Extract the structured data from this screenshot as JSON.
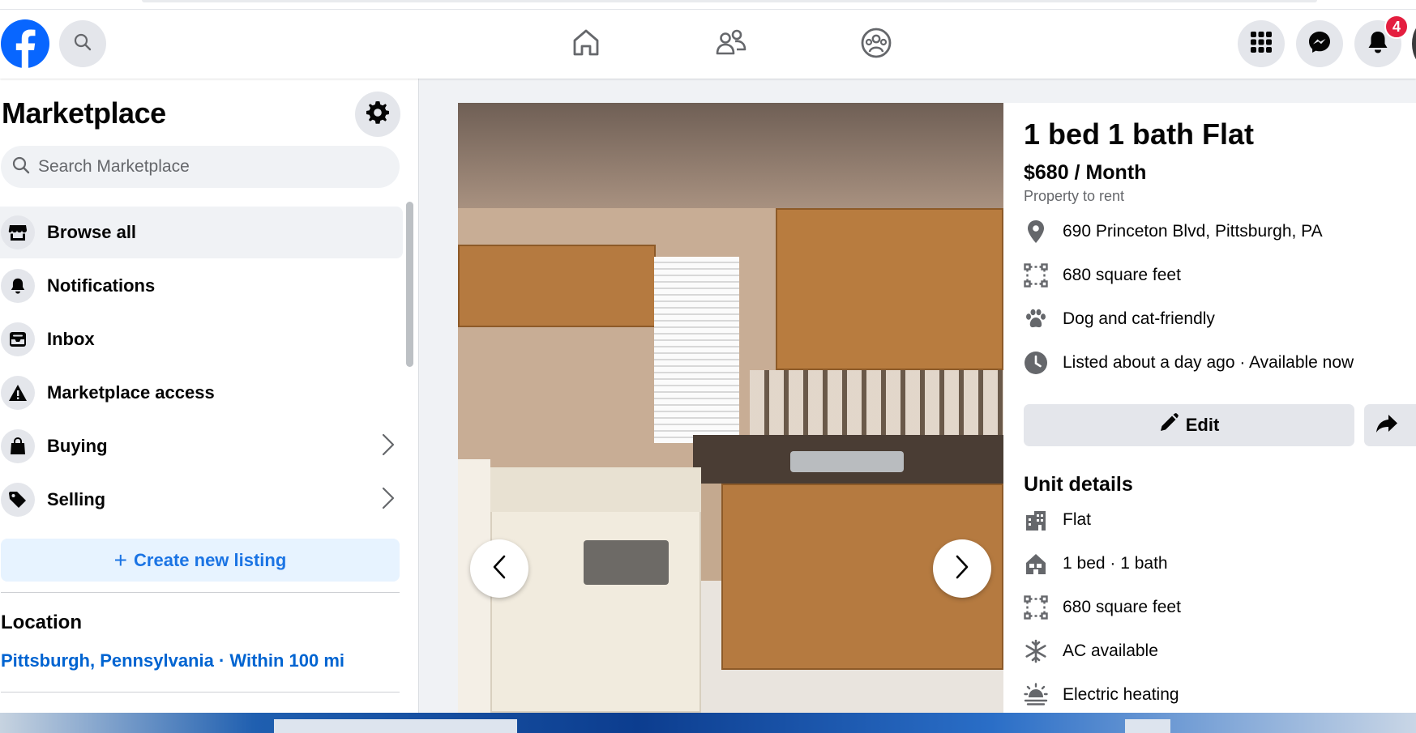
{
  "header": {
    "logo": "facebook-logo",
    "search_icon": "search-icon",
    "nav": [
      "home-icon",
      "friends-icon",
      "groups-icon"
    ],
    "right": [
      "menu-grid-icon",
      "messenger-icon",
      "bell-icon"
    ],
    "notification_count": "4"
  },
  "sidebar": {
    "title": "Marketplace",
    "search_placeholder": "Search Marketplace",
    "items": [
      {
        "label": "Browse all",
        "icon": "storefront-icon",
        "active": true
      },
      {
        "label": "Notifications",
        "icon": "bell-icon"
      },
      {
        "label": "Inbox",
        "icon": "inbox-icon"
      },
      {
        "label": "Marketplace access",
        "icon": "warning-icon"
      },
      {
        "label": "Buying",
        "icon": "shopping-bag-icon",
        "chevron": true
      },
      {
        "label": "Selling",
        "icon": "tag-icon",
        "chevron": true
      }
    ],
    "create_label": "Create new listing",
    "location_title": "Location",
    "location_value": "Pittsburgh, Pennsylvania · Within 100 mi"
  },
  "listing": {
    "title": "1 bed 1 bath Flat",
    "price": "$680 / Month",
    "category": "Property to rent",
    "facts": [
      {
        "icon": "location-pin-icon",
        "text": "690 Princeton Blvd, Pittsburgh, PA"
      },
      {
        "icon": "area-icon",
        "text": "680 square feet"
      },
      {
        "icon": "paw-icon",
        "text": "Dog and cat-friendly"
      },
      {
        "icon": "clock-icon",
        "text": "Listed about a day ago · Available now"
      }
    ],
    "edit_label": "Edit",
    "unit_details_title": "Unit details",
    "unit_details": [
      {
        "icon": "building-icon",
        "text": "Flat"
      },
      {
        "icon": "house-icon",
        "text": "1 bed · 1 bath"
      },
      {
        "icon": "area-icon",
        "text": "680 square feet"
      },
      {
        "icon": "snowflake-icon",
        "text": "AC available"
      },
      {
        "icon": "heating-icon",
        "text": "Electric heating"
      }
    ]
  },
  "colors": {
    "brand": "#0866ff",
    "link": "#0064d1",
    "badge": "#e41e3f"
  }
}
